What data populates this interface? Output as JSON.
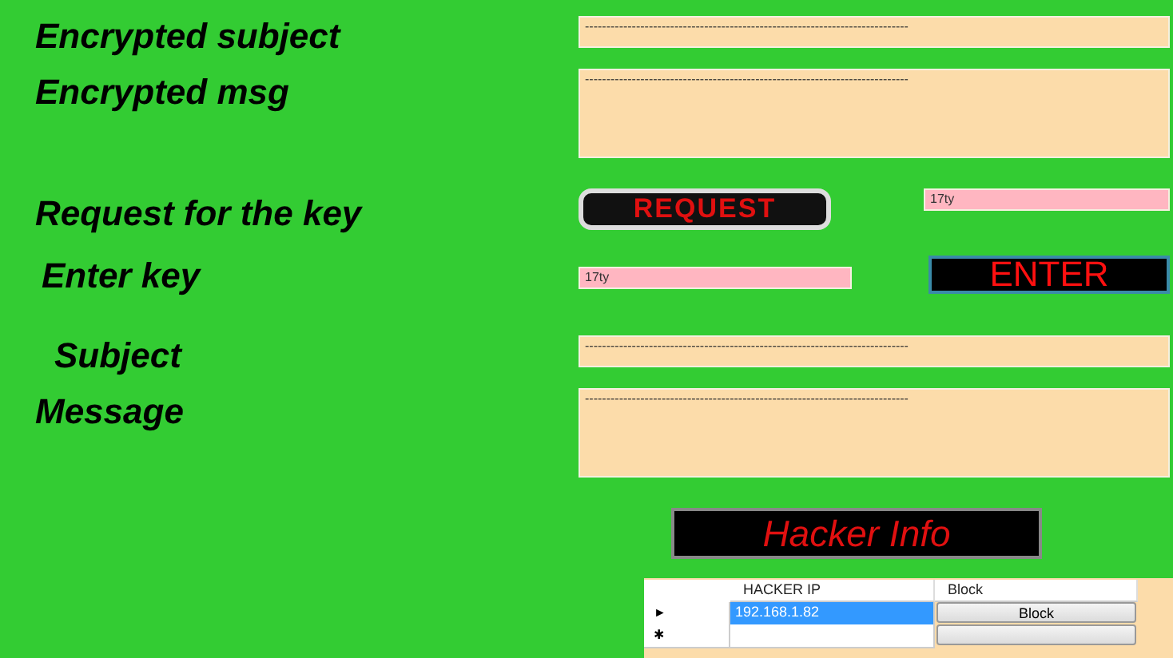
{
  "fields": [
    {
      "kind": "line",
      "label": "Encrypted subject",
      "value": "----------------------------------------------------------------------------"
    },
    {
      "kind": "area",
      "label": "Encrypted msg",
      "value": "----------------------------------------------------------------------------"
    }
  ],
  "request": {
    "label": "Request for the key",
    "button": "REQUEST",
    "key_value": "17ty"
  },
  "enter": {
    "label": "Enter key",
    "key_value": "17ty",
    "button": "ENTER"
  },
  "decrypted": [
    {
      "kind": "line",
      "label": "Subject",
      "value": "----------------------------------------------------------------------------"
    },
    {
      "kind": "area",
      "label": "Message",
      "value": "----------------------------------------------------------------------------"
    }
  ],
  "hacker_button": "Hacker Info",
  "grid": {
    "columns": [
      "HACKER IP",
      "Block"
    ],
    "rows": [
      {
        "marker": "►",
        "ip": "192.168.1.82",
        "button": "Block",
        "selected": true
      },
      {
        "marker": "✱",
        "ip": "",
        "button": "",
        "selected": false
      }
    ]
  }
}
